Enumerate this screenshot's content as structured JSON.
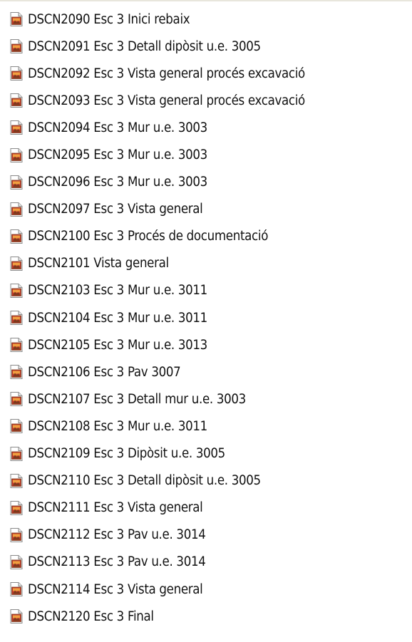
{
  "colors": {
    "background": "#ffffff",
    "text": "#111111",
    "icon_page": "#ffffff",
    "icon_border": "#8a8a8a",
    "icon_photo_red": "#c0392b",
    "icon_photo_orange": "#f0a040",
    "icon_photo_brown": "#7a3b1c"
  },
  "icon": "image-file-icon",
  "files": [
    {
      "name": "DSCN2090 Esc 3 Inici rebaix"
    },
    {
      "name": "DSCN2091 Esc 3 Detall dipòsit u.e. 3005"
    },
    {
      "name": "DSCN2092 Esc 3 Vista general procés excavació"
    },
    {
      "name": "DSCN2093 Esc 3 Vista general procés excavació"
    },
    {
      "name": "DSCN2094 Esc 3 Mur u.e. 3003"
    },
    {
      "name": "DSCN2095 Esc 3 Mur u.e. 3003"
    },
    {
      "name": "DSCN2096 Esc 3 Mur u.e. 3003"
    },
    {
      "name": "DSCN2097 Esc 3 Vista general"
    },
    {
      "name": "DSCN2100 Esc  3 Procés de documentació"
    },
    {
      "name": "DSCN2101 Vista general"
    },
    {
      "name": "DSCN2103 Esc 3 Mur u.e. 3011"
    },
    {
      "name": "DSCN2104 Esc 3 Mur u.e. 3011"
    },
    {
      "name": "DSCN2105 Esc 3 Mur u.e. 3013"
    },
    {
      "name": "DSCN2106 Esc 3 Pav 3007"
    },
    {
      "name": "DSCN2107 Esc 3 Detall mur u.e. 3003"
    },
    {
      "name": "DSCN2108 Esc 3 Mur u.e. 3011"
    },
    {
      "name": "DSCN2109 Esc 3 Dipòsit u.e. 3005"
    },
    {
      "name": "DSCN2110 Esc 3 Detall dipòsit u.e. 3005"
    },
    {
      "name": "DSCN2111 Esc 3 Vista general"
    },
    {
      "name": "DSCN2112 Esc 3 Pav u.e. 3014"
    },
    {
      "name": "DSCN2113 Esc  3 Pav u.e. 3014"
    },
    {
      "name": "DSCN2114 Esc 3 Vista general"
    },
    {
      "name": "DSCN2120 Esc 3 Final"
    }
  ]
}
